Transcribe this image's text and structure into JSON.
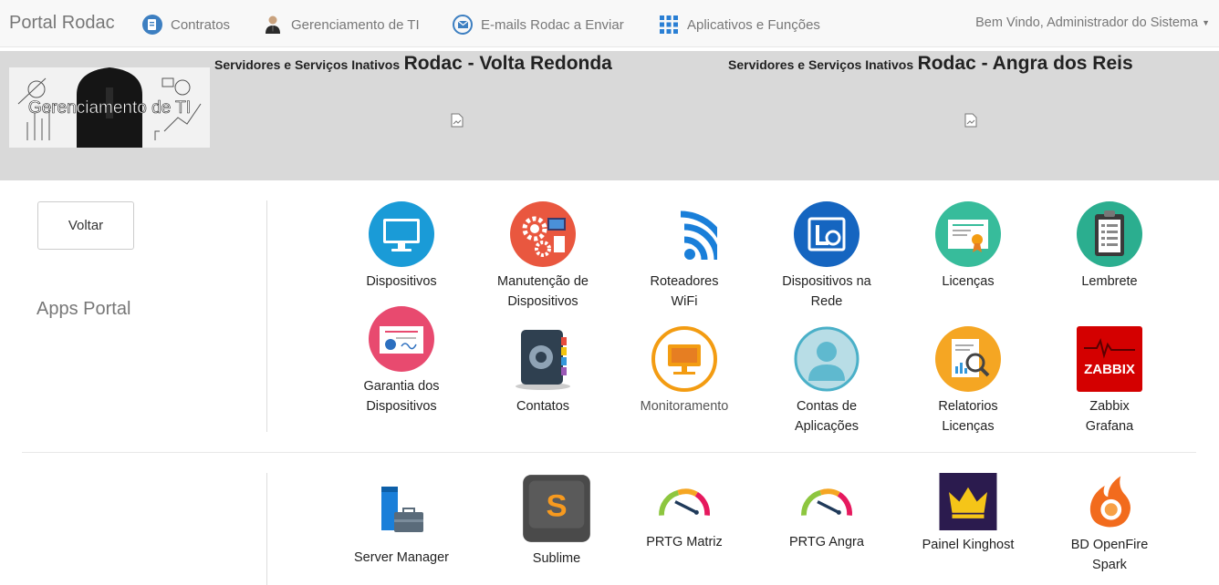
{
  "navbar": {
    "brand": "Portal Rodac",
    "items": [
      {
        "label": "Contratos",
        "icon": "contract-icon"
      },
      {
        "label": "Gerenciamento de TI",
        "icon": "user-tie-icon"
      },
      {
        "label": "E-mails Rodac a Enviar",
        "icon": "email-icon"
      },
      {
        "label": "Aplicativos e Funções",
        "icon": "apps-grid-icon"
      }
    ],
    "user": "Bem Vindo, Administrador do Sistema"
  },
  "banner": {
    "image_text": "Gerenciamento de TI",
    "panels": [
      {
        "small": "Servidores e Serviços Inativos",
        "big": "Rodac - Volta Redonda"
      },
      {
        "small": "Servidores e Serviços Inativos",
        "big": "Rodac - Angra dos Reis"
      }
    ]
  },
  "sidebar": {
    "back_button": "Voltar",
    "section_title": "Apps Portal"
  },
  "apps": [
    {
      "line1": "Dispositivos",
      "line2": ""
    },
    {
      "line1": "Manutenção de",
      "line2": "Dispositivos"
    },
    {
      "line1": "Roteadores",
      "line2": "WiFi"
    },
    {
      "line1": "Dispositivos na",
      "line2": "Rede"
    },
    {
      "line1": "Licenças",
      "line2": ""
    },
    {
      "line1": "Lembrete",
      "line2": ""
    },
    {
      "line1": "Garantia dos",
      "line2": "Dispositivos"
    },
    {
      "line1": "Contatos",
      "line2": ""
    },
    {
      "line1": "Monitoramento",
      "line2": ""
    },
    {
      "line1": "Contas de",
      "line2": "Aplicações"
    },
    {
      "line1": "Relatorios",
      "line2": "Licenças"
    },
    {
      "line1": "Zabbix",
      "line2": "Grafana"
    },
    {
      "line1": "Server Manager",
      "line2": ""
    },
    {
      "line1": "Sublime",
      "line2": ""
    },
    {
      "line1": "PRTG Matriz",
      "line2": ""
    },
    {
      "line1": "PRTG Angra",
      "line2": ""
    },
    {
      "line1": "Painel Kinghost",
      "line2": ""
    },
    {
      "line1": "BD OpenFire",
      "line2": "Spark"
    }
  ],
  "icon_texts": {
    "zabbix": "ZABBIX",
    "sublime": "S"
  },
  "colors": {
    "blue": "#1a9bd7",
    "red": "#e9573f",
    "green": "#37bc9b",
    "orange": "#f39c12",
    "pink": "#e84a6f",
    "zabbix": "#d40000"
  }
}
